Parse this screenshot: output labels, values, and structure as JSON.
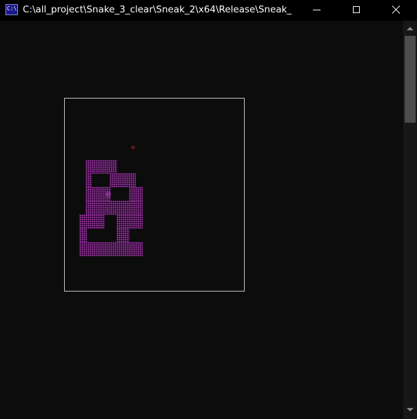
{
  "window": {
    "title": "C:\\all_project\\Snake_3_clear\\Sneak_2\\x64\\Release\\Sneak_...",
    "app_icon_text": "C:\\"
  },
  "controls": {
    "minimize_icon": "minimize-icon",
    "maximize_icon": "maximize-icon",
    "close_icon": "close-icon"
  },
  "game": {
    "food_symbol": "*",
    "head_symbol": "@",
    "colors": {
      "snake": "#b040b8",
      "food": "#cc1a2a",
      "border": "#c8c8c8",
      "background": "#0c0c0c"
    }
  }
}
